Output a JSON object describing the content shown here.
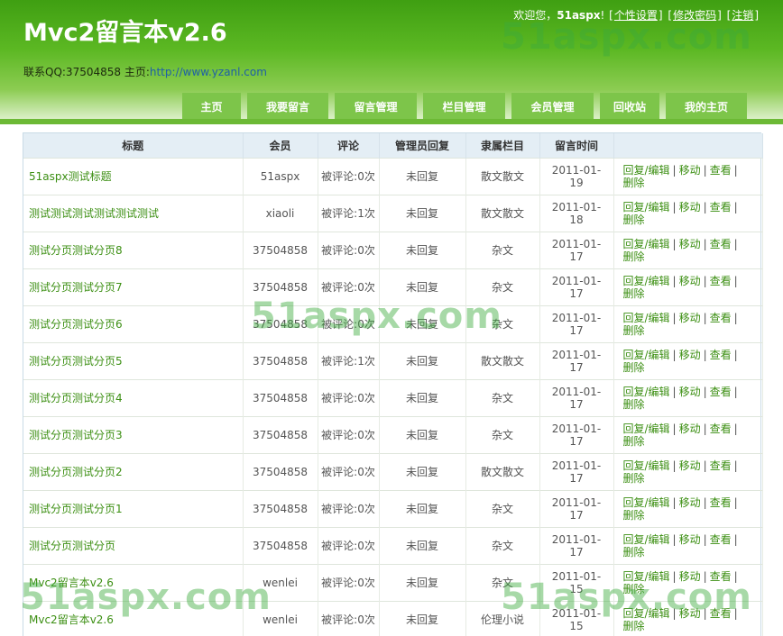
{
  "header": {
    "title": "Mvc2留言本v2.6",
    "contact_prefix": "联系QQ:37504858 主页:",
    "homepage_link": "http://www.yzanl.com",
    "welcome": "欢迎您，",
    "username": "51aspx",
    "exclaim": "!",
    "links": [
      "个性设置",
      "修改密码",
      "注销"
    ],
    "bracket_open": "[",
    "bracket_close": "]"
  },
  "watermark": "51aspx.com",
  "nav": [
    {
      "label": "主页"
    },
    {
      "label": "我要留言"
    },
    {
      "label": "留言管理"
    },
    {
      "label": "栏目管理"
    },
    {
      "label": "会员管理"
    },
    {
      "label": "回收站"
    },
    {
      "label": "我的主页"
    }
  ],
  "table": {
    "headers": [
      "标题",
      "会员",
      "评论",
      "管理员回复",
      "隶属栏目",
      "留言时间",
      ""
    ],
    "op_labels": {
      "reply_edit": "回复/编辑",
      "move": "移动",
      "view": "查看",
      "delete": "删除",
      "sep": "|"
    },
    "rows": [
      {
        "title": "51aspx测试标题",
        "member": "51aspx",
        "comments": "被评论:0次",
        "reply": "未回复",
        "category": "散文散文",
        "date1": "2011-01-",
        "date2": "19"
      },
      {
        "title": "测试测试测试测试测试测试",
        "member": "xiaoli",
        "comments": "被评论:1次",
        "reply": "未回复",
        "category": "散文散文",
        "date1": "2011-01-",
        "date2": "18"
      },
      {
        "title": "测试分页测试分页8",
        "member": "37504858",
        "comments": "被评论:0次",
        "reply": "未回复",
        "category": "杂文",
        "date1": "2011-01-",
        "date2": "17"
      },
      {
        "title": "测试分页测试分页7",
        "member": "37504858",
        "comments": "被评论:0次",
        "reply": "未回复",
        "category": "杂文",
        "date1": "2011-01-",
        "date2": "17"
      },
      {
        "title": "测试分页测试分页6",
        "member": "37504858",
        "comments": "被评论:0次",
        "reply": "未回复",
        "category": "杂文",
        "date1": "2011-01-",
        "date2": "17"
      },
      {
        "title": "测试分页测试分页5",
        "member": "37504858",
        "comments": "被评论:1次",
        "reply": "未回复",
        "category": "散文散文",
        "date1": "2011-01-",
        "date2": "17"
      },
      {
        "title": "测试分页测试分页4",
        "member": "37504858",
        "comments": "被评论:0次",
        "reply": "未回复",
        "category": "杂文",
        "date1": "2011-01-",
        "date2": "17"
      },
      {
        "title": "测试分页测试分页3",
        "member": "37504858",
        "comments": "被评论:0次",
        "reply": "未回复",
        "category": "杂文",
        "date1": "2011-01-",
        "date2": "17"
      },
      {
        "title": "测试分页测试分页2",
        "member": "37504858",
        "comments": "被评论:0次",
        "reply": "未回复",
        "category": "散文散文",
        "date1": "2011-01-",
        "date2": "17"
      },
      {
        "title": "测试分页测试分页1",
        "member": "37504858",
        "comments": "被评论:0次",
        "reply": "未回复",
        "category": "杂文",
        "date1": "2011-01-",
        "date2": "17"
      },
      {
        "title": "测试分页测试分页",
        "member": "37504858",
        "comments": "被评论:0次",
        "reply": "未回复",
        "category": "杂文",
        "date1": "2011-01-",
        "date2": "17"
      },
      {
        "title": "Mvc2留言本v2.6",
        "member": "wenlei",
        "comments": "被评论:0次",
        "reply": "未回复",
        "category": "杂文",
        "date1": "2011-01-",
        "date2": "15"
      },
      {
        "title": "Mvc2留言本v2.6",
        "member": "wenlei",
        "comments": "被评论:0次",
        "reply": "未回复",
        "category": "伦理小说",
        "date1": "2011-01-",
        "date2": "15"
      }
    ]
  }
}
